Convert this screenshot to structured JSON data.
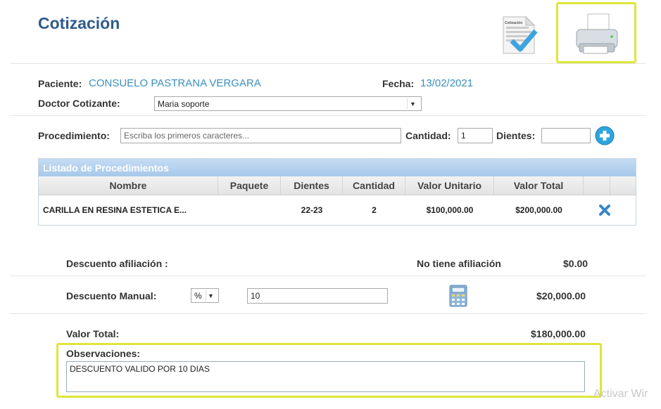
{
  "page": {
    "title": "Cotización"
  },
  "toolbar": {
    "quote_doc_label": "Cotización"
  },
  "header": {
    "patient_label": "Paciente:",
    "patient_name": "CONSUELO PASTRANA VERGARA",
    "date_label": "Fecha:",
    "date_value": "13/02/2021",
    "doctor_label": "Doctor Cotizante:",
    "doctor_value": "Maria soporte"
  },
  "procedure": {
    "label": "Procedimiento:",
    "placeholder": "Escriba los primeros caracteres...",
    "qty_label": "Cantidad:",
    "qty_value": "1",
    "teeth_label": "Dientes:",
    "teeth_value": ""
  },
  "grid": {
    "caption": "Listado de Procedimientos",
    "columns": [
      "Nombre",
      "Paquete",
      "Dientes",
      "Cantidad",
      "Valor Unitario",
      "Valor Total"
    ],
    "rows": [
      {
        "nombre": "CARILLA EN RESINA ESTETICA E...",
        "paquete": "",
        "dientes": "22-23",
        "cantidad": "2",
        "valor_unitario": "$100,000.00",
        "valor_total": "$200,000.00"
      }
    ]
  },
  "totals": {
    "affiliation_label": "Descuento afiliación :",
    "affiliation_status": "No tiene afiliación",
    "affiliation_value": "$0.00",
    "manual_label": "Descuento Manual:",
    "manual_type": "%",
    "manual_value": "10",
    "manual_amount": "$20,000.00",
    "total_label": "Valor Total:",
    "total_value": "$180,000.00"
  },
  "observations": {
    "label": "Observaciones:",
    "value": "DESCUENTO VALIDO POR 10 DIAS"
  },
  "overlay": {
    "watermark": "Activar Wir"
  },
  "colors": {
    "highlight": "#dde63a",
    "title": "#2f5b8a",
    "link": "#3a8fbf"
  }
}
